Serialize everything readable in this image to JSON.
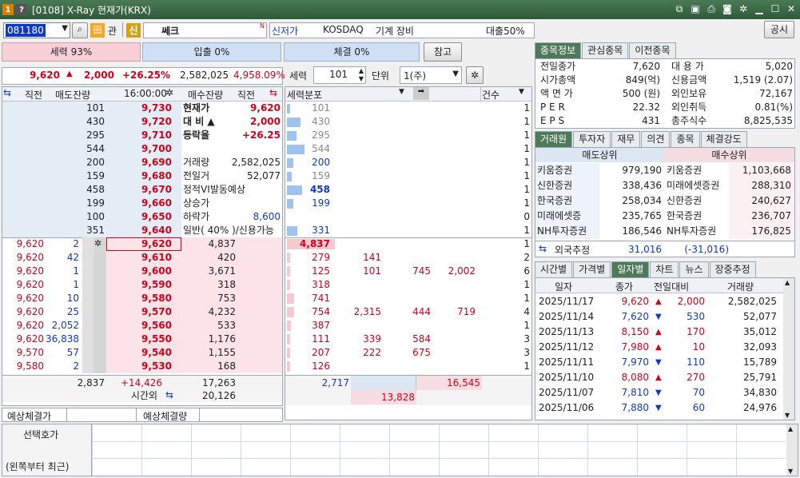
{
  "window": {
    "title": "[0108] X-Ray 현재가(KRX)",
    "icon1": "1",
    "icon2": "?"
  },
  "header": {
    "code": "081180",
    "badge_kwan": "관",
    "badge_sin": "신",
    "stock_name": "쎄크",
    "n_mark": "N",
    "market": "신저가",
    "exchange": "KOSDAQ",
    "sector": "기계 장비",
    "loan_rate": "대출50%",
    "notice_btn": "공시"
  },
  "bars": {
    "force": "세력 93%",
    "inout": "입출 0%",
    "exec": "체결 0%",
    "ref_btn": "참고"
  },
  "summary": {
    "price": "9,620",
    "arrow": "▲",
    "change": "2,000",
    "rate": "+26.25%",
    "volume": "2,582,025",
    "vol_pct": "4,958.09%"
  },
  "force_ctrl": {
    "label": "세력",
    "value": "101",
    "unit_label": "단위",
    "unit": "1(주)"
  },
  "orderbook": {
    "headers": {
      "direct": "직전",
      "sell": "매도잔량",
      "time": "16:00:00",
      "buy": "매수잔량",
      "direct2": "직전"
    },
    "asks": [
      {
        "qty": "101",
        "price": "9,730",
        "info_label": "현재가",
        "info_value": "9,620"
      },
      {
        "qty": "430",
        "price": "9,720",
        "info_label": "대 비 ▲",
        "info_value": "2,000"
      },
      {
        "qty": "295",
        "price": "9,710",
        "info_label": "등락율",
        "info_value": "+26.25"
      },
      {
        "qty": "544",
        "price": "9,700",
        "info_label": "",
        "info_value": ""
      },
      {
        "qty": "200",
        "price": "9,690",
        "info_label": "거래량",
        "info_value": "2,582,025"
      },
      {
        "qty": "159",
        "price": "9,680",
        "info_label": "전일거",
        "info_value": "52,077"
      },
      {
        "qty": "458",
        "price": "9,670",
        "info_label": "정적VI발동예상",
        "info_value": ""
      },
      {
        "qty": "199",
        "price": "9,660",
        "info_label": "상승가",
        "info_value": ""
      },
      {
        "qty": "100",
        "price": "9,650",
        "info_label": "하락가",
        "info_value": "8,600"
      },
      {
        "qty": "351",
        "price": "9,640",
        "info_label": "일반( 40% )/신용가능",
        "info_value": ""
      }
    ],
    "bids": [
      {
        "p": "9,620",
        "q": "2",
        "price": "9,620",
        "qty": "4,837"
      },
      {
        "p": "9,620",
        "q": "42",
        "price": "9,610",
        "qty": "420"
      },
      {
        "p": "9,620",
        "q": "1",
        "price": "9,600",
        "qty": "3,671"
      },
      {
        "p": "9,620",
        "q": "1",
        "price": "9,590",
        "qty": "318"
      },
      {
        "p": "9,620",
        "q": "10",
        "price": "9,580",
        "qty": "753"
      },
      {
        "p": "9,620",
        "q": "25",
        "price": "9,570",
        "qty": "4,232"
      },
      {
        "p": "9,620",
        "q": "2,052",
        "price": "9,560",
        "qty": "533"
      },
      {
        "p": "9,620",
        "q": "36,838",
        "price": "9,550",
        "qty": "1,176"
      },
      {
        "p": "9,570",
        "q": "57",
        "price": "9,540",
        "qty": "1,155"
      },
      {
        "p": "9,580",
        "q": "2",
        "price": "9,530",
        "qty": "168"
      }
    ],
    "totals": {
      "sell": "2,837",
      "diff": "+14,426",
      "buy": "17,263",
      "after_label": "시간외",
      "after": "20,126"
    },
    "expected_price_label": "예상체결가",
    "expected_qty_label": "예상체결량"
  },
  "force_dist": {
    "header": "세력분포",
    "count_header": "건수",
    "ask_rows": [
      {
        "v": "101",
        "c": "1"
      },
      {
        "v": "430",
        "c": "1"
      },
      {
        "v": "295",
        "c": "1"
      },
      {
        "v": "544",
        "c": "1"
      },
      {
        "v": "200",
        "c": "1"
      },
      {
        "v": "159",
        "c": "1"
      },
      {
        "v": "458",
        "c": "1"
      },
      {
        "v": "199",
        "c": "1"
      },
      {
        "v": "",
        "c": "0"
      },
      {
        "v": "331",
        "c": "1"
      }
    ],
    "bid_rows": [
      {
        "v": [
          "4,837",
          "",
          "",
          ""
        ],
        "c": "1"
      },
      {
        "v": [
          "279",
          "141",
          "",
          ""
        ],
        "c": "2"
      },
      {
        "v": [
          "125",
          "101",
          "745",
          "2,002"
        ],
        "c": "6"
      },
      {
        "v": [
          "318",
          "",
          "",
          ""
        ],
        "c": "1"
      },
      {
        "v": [
          "741",
          "",
          "",
          ""
        ],
        "c": "1"
      },
      {
        "v": [
          "754",
          "2,315",
          "444",
          "719"
        ],
        "c": "4"
      },
      {
        "v": [
          "387",
          "",
          "",
          ""
        ],
        "c": "1"
      },
      {
        "v": [
          "111",
          "339",
          "584",
          ""
        ],
        "c": "3"
      },
      {
        "v": [
          "207",
          "222",
          "675",
          ""
        ],
        "c": "3"
      },
      {
        "v": [
          "126",
          "",
          "",
          ""
        ],
        "c": "1"
      }
    ],
    "totals": {
      "a": "2,717",
      "b": "16,545",
      "c": "13,828"
    }
  },
  "info_tabs": [
    "종목정보",
    "관심종목",
    "이전종목"
  ],
  "info": [
    {
      "l1": "전일종가",
      "v1": "7,620",
      "l2": "대 용 가",
      "v2": "5,020"
    },
    {
      "l1": "시가총액",
      "v1": "849(억)",
      "l2": "신용금액",
      "v2": "1,519 (2.07)"
    },
    {
      "l1": "액 면 가",
      "v1": "500 (원)",
      "l2": "외인보유",
      "v2": "72,167"
    },
    {
      "l1": "P E R",
      "v1": "22.32",
      "l2": "외인취득",
      "v2": "0.81(%)"
    },
    {
      "l1": "E P S",
      "v1": "431",
      "l2": "총주식수",
      "v2": "8,825,535"
    }
  ],
  "broker_tabs": [
    "거래원",
    "투자자",
    "재무",
    "의견",
    "종목",
    "체결강도"
  ],
  "brokers": {
    "sell_header": "매도상위",
    "buy_header": "매수상위",
    "rows": [
      {
        "s": "키움증권",
        "sv": "979,190",
        "b": "키움증권",
        "bv": "1,103,668"
      },
      {
        "s": "신한증권",
        "sv": "338,436",
        "b": "미래에셋증권",
        "bv": "288,310"
      },
      {
        "s": "한국증권",
        "sv": "258,034",
        "b": "신한증권",
        "bv": "240,627"
      },
      {
        "s": "미래에셋증",
        "sv": "235,765",
        "b": "한국증권",
        "bv": "236,707"
      },
      {
        "s": "NH투자증권",
        "sv": "186,546",
        "b": "NH투자증권",
        "bv": "176,825"
      }
    ],
    "foreign_label": "외국추정",
    "foreign_sell": "31,016",
    "foreign_net": "(-31,016)"
  },
  "daily_tabs": [
    "시간별",
    "가격별",
    "일자별",
    "차트",
    "뉴스",
    "장중추정"
  ],
  "daily": {
    "headers": [
      "일자",
      "종가",
      "전일대비",
      "거래량"
    ],
    "rows": [
      {
        "d": "2025/11/17",
        "c": "9,620",
        "dir": "▲",
        "chg": "2,000",
        "v": "2,582,025",
        "up": true
      },
      {
        "d": "2025/11/14",
        "c": "7,620",
        "dir": "▼",
        "chg": "530",
        "v": "52,077",
        "up": false
      },
      {
        "d": "2025/11/13",
        "c": "8,150",
        "dir": "▲",
        "chg": "170",
        "v": "35,012",
        "up": true
      },
      {
        "d": "2025/11/12",
        "c": "7,980",
        "dir": "▲",
        "chg": "10",
        "v": "32,093",
        "up": true
      },
      {
        "d": "2025/11/11",
        "c": "7,970",
        "dir": "▼",
        "chg": "110",
        "v": "15,789",
        "up": false
      },
      {
        "d": "2025/11/10",
        "c": "8,080",
        "dir": "▲",
        "chg": "270",
        "v": "25,791",
        "up": true
      },
      {
        "d": "2025/11/07",
        "c": "7,810",
        "dir": "▼",
        "chg": "70",
        "v": "34,830",
        "up": false
      },
      {
        "d": "2025/11/06",
        "c": "7,880",
        "dir": "▼",
        "chg": "60",
        "v": "24,976",
        "up": false
      }
    ]
  },
  "bottom": {
    "label1": "선택호가",
    "label2": "(왼쪽부터 최근)"
  }
}
